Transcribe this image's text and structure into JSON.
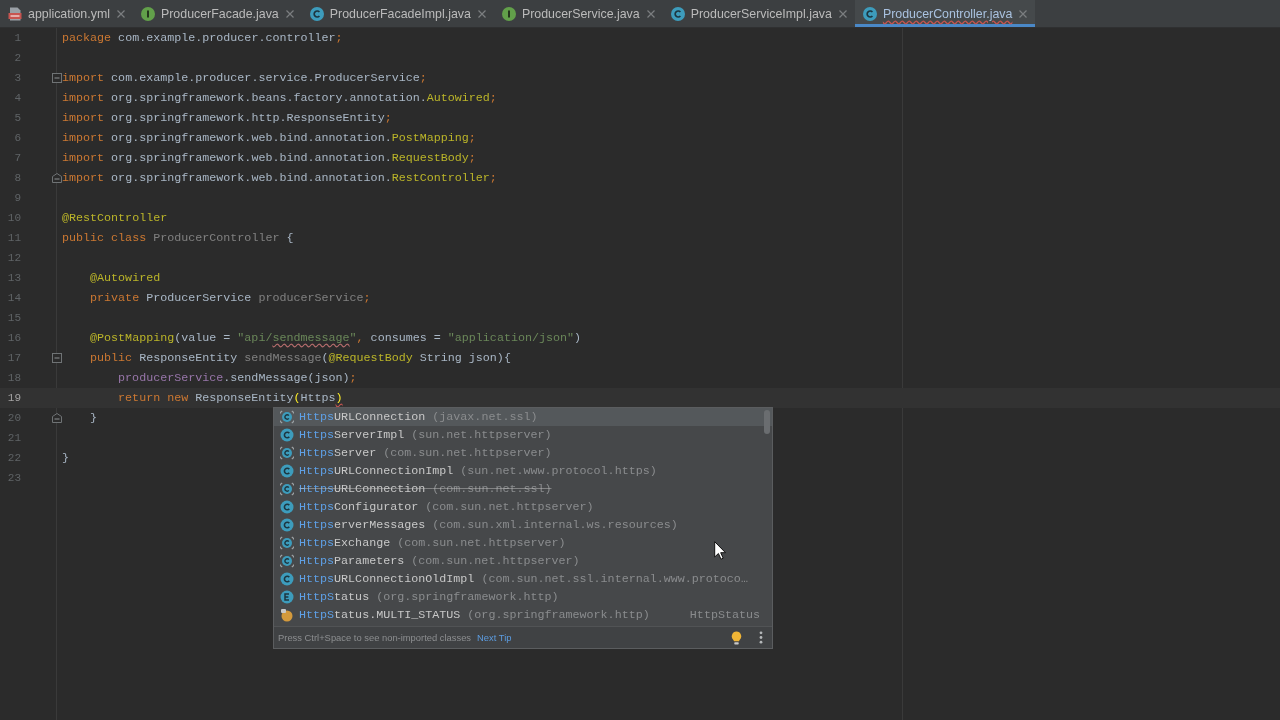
{
  "tabs": [
    {
      "label": "application.yml",
      "kind": "yaml",
      "selected": false,
      "error": false
    },
    {
      "label": "ProducerFacade.java",
      "kind": "interface",
      "selected": false,
      "error": false
    },
    {
      "label": "ProducerFacadeImpl.java",
      "kind": "class",
      "selected": false,
      "error": false
    },
    {
      "label": "ProducerService.java",
      "kind": "interface",
      "selected": false,
      "error": false
    },
    {
      "label": "ProducerServiceImpl.java",
      "kind": "class",
      "selected": false,
      "error": false
    },
    {
      "label": "ProducerController.java",
      "kind": "class",
      "selected": true,
      "error": true
    }
  ],
  "editor": {
    "lines": [
      {
        "number": "1",
        "current": false,
        "tokens": [
          {
            "text": "package",
            "kind": "keyword"
          },
          {
            "text": " com.example.producer.controller",
            "kind": "plain"
          },
          {
            "text": ";",
            "kind": "keyword"
          }
        ]
      },
      {
        "number": "2",
        "current": false
      },
      {
        "number": "3",
        "current": false,
        "fold": {
          "kind": "start"
        },
        "tokens": [
          {
            "text": "import",
            "kind": "keyword"
          },
          {
            "text": " com.example.producer.service.ProducerService",
            "kind": "plain"
          },
          {
            "text": ";",
            "kind": "keyword"
          }
        ]
      },
      {
        "number": "4",
        "current": false,
        "tokens": [
          {
            "text": "import",
            "kind": "keyword"
          },
          {
            "text": " org.springframework.beans.factory.annotation.",
            "kind": "plain"
          },
          {
            "text": "Autowired",
            "kind": "annotation"
          },
          {
            "text": ";",
            "kind": "keyword"
          }
        ]
      },
      {
        "number": "5",
        "current": false,
        "tokens": [
          {
            "text": "import",
            "kind": "keyword"
          },
          {
            "text": " org.springframework.http.ResponseEntity",
            "kind": "plain"
          },
          {
            "text": ";",
            "kind": "keyword"
          }
        ]
      },
      {
        "number": "6",
        "current": false,
        "tokens": [
          {
            "text": "import",
            "kind": "keyword"
          },
          {
            "text": " org.springframework.web.bind.annotation.",
            "kind": "plain"
          },
          {
            "text": "PostMapping",
            "kind": "annotation"
          },
          {
            "text": ";",
            "kind": "keyword"
          }
        ]
      },
      {
        "number": "7",
        "current": false,
        "tokens": [
          {
            "text": "import",
            "kind": "keyword"
          },
          {
            "text": " org.springframework.web.bind.annotation.",
            "kind": "plain"
          },
          {
            "text": "RequestBody",
            "kind": "annotation"
          },
          {
            "text": ";",
            "kind": "keyword"
          }
        ]
      },
      {
        "number": "8",
        "current": false,
        "fold": {
          "kind": "end"
        },
        "tokens": [
          {
            "text": "import",
            "kind": "keyword"
          },
          {
            "text": " org.springframework.web.bind.annotation.",
            "kind": "plain"
          },
          {
            "text": "RestController",
            "kind": "annotation"
          },
          {
            "text": ";",
            "kind": "keyword"
          }
        ]
      },
      {
        "number": "9",
        "current": false
      },
      {
        "number": "10",
        "current": false,
        "tokens": [
          {
            "text": "@RestController",
            "kind": "annotation"
          }
        ]
      },
      {
        "number": "11",
        "current": false,
        "tokens": [
          {
            "text": "public class ",
            "kind": "keyword"
          },
          {
            "text": "ProducerController",
            "kind": "unused"
          },
          {
            "text": " {",
            "kind": "plain"
          }
        ],
        "children": [
          {
            "number": "12",
            "current": false
          },
          {
            "number": "13",
            "current": false,
            "tokens": [
              {
                "text": "@Autowired",
                "kind": "annotation"
              }
            ]
          },
          {
            "number": "14",
            "current": false,
            "tokens": [
              {
                "text": "private",
                "kind": "keyword"
              },
              {
                "text": " ProducerService ",
                "kind": "plain"
              },
              {
                "text": "producerService",
                "kind": "unused"
              },
              {
                "text": ";",
                "kind": "keyword"
              }
            ]
          },
          {
            "number": "15",
            "current": false
          },
          {
            "number": "16",
            "current": false,
            "tokens": [
              {
                "text": "@PostMapping",
                "kind": "annotation"
              },
              {
                "text": "(value = ",
                "kind": "plain"
              },
              {
                "text": "\"api/",
                "kind": "string"
              },
              {
                "text": "sendmessage",
                "kind": "string_typo"
              },
              {
                "text": "\"",
                "kind": "string"
              },
              {
                "text": ",",
                "kind": "keyword"
              },
              {
                "text": " consumes = ",
                "kind": "plain"
              },
              {
                "text": "\"application/json\"",
                "kind": "string"
              },
              {
                "text": ")",
                "kind": "plain"
              }
            ]
          },
          {
            "number": "17",
            "current": false,
            "fold": {
              "kind": "start"
            },
            "tokens": [
              {
                "text": "public",
                "kind": "keyword"
              },
              {
                "text": " ResponseEntity ",
                "kind": "plain"
              },
              {
                "text": "sendMessage",
                "kind": "unused"
              },
              {
                "text": "(",
                "kind": "plain"
              },
              {
                "text": "@RequestBody",
                "kind": "annotation"
              },
              {
                "text": " String json){",
                "kind": "plain"
              }
            ],
            "children": [
              {
                "number": "18",
                "current": false,
                "tokens": [
                  {
                    "text": "producerService",
                    "kind": "field"
                  },
                  {
                    "text": ".sendMessage(json)",
                    "kind": "plain"
                  },
                  {
                    "text": ";",
                    "kind": "keyword"
                  }
                ]
              },
              {
                "number": "19",
                "current": true,
                "tokens": [
                  {
                    "text": "return new ",
                    "kind": "keyword"
                  },
                  {
                    "text": "ResponseEntity",
                    "kind": "plain"
                  },
                  {
                    "text": "(",
                    "kind": "brace_match"
                  },
                  {
                    "text": "Https",
                    "kind": "plain"
                  },
                  {
                    "text": ")",
                    "kind": "brace_error"
                  }
                ]
              }
            ]
          },
          {
            "number": "20",
            "current": false,
            "fold": {
              "kind": "end"
            },
            "tokens": [
              {
                "text": "}",
                "kind": "plain"
              }
            ]
          },
          {
            "number": "21",
            "current": false
          }
        ]
      },
      {
        "number": "22",
        "current": false,
        "tokens": [
          {
            "text": "}",
            "kind": "plain"
          }
        ]
      },
      {
        "number": "23",
        "current": false
      }
    ]
  },
  "completion_popup": {
    "items": [
      {
        "kind": "abstract_class",
        "match": "Https",
        "rest": "URLConnection",
        "package": "(javax.net.ssl)",
        "selected": true,
        "deprecated": false
      },
      {
        "kind": "class",
        "match": "Https",
        "rest": "ServerImpl",
        "package": "(sun.net.httpserver)",
        "selected": false,
        "deprecated": false
      },
      {
        "kind": "abstract_class",
        "match": "Https",
        "rest": "Server",
        "package": "(com.sun.net.httpserver)",
        "selected": false,
        "deprecated": false
      },
      {
        "kind": "class",
        "match": "Https",
        "rest": "URLConnectionImpl",
        "package": "(sun.net.www.protocol.https)",
        "selected": false,
        "deprecated": false
      },
      {
        "kind": "abstract_class",
        "match": "Https",
        "rest": "URLConnection",
        "package": "(com.sun.net.ssl)",
        "selected": false,
        "deprecated": true
      },
      {
        "kind": "class",
        "match": "Https",
        "rest": "Configurator",
        "package": "(com.sun.net.httpserver)",
        "selected": false,
        "deprecated": false
      },
      {
        "kind": "class",
        "match": "Https",
        "rest": "erverMessages",
        "package": "(com.sun.xml.internal.ws.resources)",
        "selected": false,
        "deprecated": false
      },
      {
        "kind": "abstract_class",
        "match": "Https",
        "rest": "Exchange",
        "package": "(com.sun.net.httpserver)",
        "selected": false,
        "deprecated": false
      },
      {
        "kind": "abstract_class",
        "match": "Https",
        "rest": "Parameters",
        "package": "(com.sun.net.httpserver)",
        "selected": false,
        "deprecated": false
      },
      {
        "kind": "class",
        "match": "Https",
        "rest": "URLConnectionOldImpl",
        "package": "(com.sun.net.ssl.internal.www.protoco…",
        "selected": false,
        "deprecated": false
      },
      {
        "kind": "enum",
        "match": "HttpS",
        "rest": "tatus",
        "package": "(org.springframework.http)",
        "selected": false,
        "deprecated": false
      },
      {
        "kind": "constant",
        "match": "HttpS",
        "rest": "tatus.MULTI_STATUS",
        "package": "(org.springframework.http)",
        "type": "HttpStatus",
        "selected": false,
        "deprecated": false
      }
    ],
    "hint": "Press Ctrl+Space to see non-imported classes",
    "next_tip": "Next Tip"
  }
}
